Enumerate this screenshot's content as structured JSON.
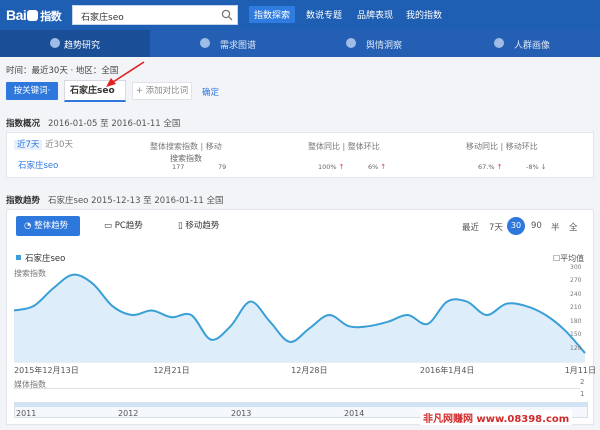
{
  "header": {
    "logo_text": "Bai",
    "logo_sub": "指数",
    "search_value": "石家庄seo",
    "nav": [
      "指数探索",
      "数说专题",
      "品牌表现",
      "我的指数"
    ]
  },
  "subnav": {
    "items": [
      "趋势研究",
      "需求图谱",
      "舆情洞察",
      "人群画像"
    ]
  },
  "filters": {
    "meta": "时间：最近30天 · 地区：全国",
    "by_keyword": "按关键词·",
    "keyword": "石家庄seo",
    "add_compare": "+ 添加对比词",
    "confirm": "确定"
  },
  "overview": {
    "title": "指数概况",
    "range": "2016-01-05 至 2016-01-11  全国",
    "tab_7": "近7天",
    "tab_30": "近30天",
    "head_search": "整体搜索指数 | 移动",
    "head_yoy": "整体同比 | 整体环比",
    "head_mobile": "移动同比 | 移动环比",
    "keyword": "石家庄seo",
    "sub_label": "搜索指数",
    "v_total": "177",
    "v_mobile": "79",
    "v_yoy": "100%",
    "v_mom": "6%",
    "v_myoy": "67.%",
    "v_mmom": "-8%"
  },
  "trend": {
    "title": "指数趋势",
    "range": "石家庄seo  2015-12-13 至 2016-01-11  全国",
    "tab_all": "整体趋势",
    "tab_pc": "PC趋势",
    "tab_mobile": "移动趋势",
    "recent": "最近",
    "r7": "7天",
    "r30": "30",
    "r90": "90",
    "rhalf": "半",
    "rall": "全",
    "legend": "石家庄seo",
    "avg": "平均值",
    "ylabel": "搜索指数",
    "media_label": "媒体指数",
    "years": [
      "2011",
      "2012",
      "2013",
      "2014"
    ]
  },
  "watermark": "非凡网赚网 www.08398.com",
  "chart_data": {
    "type": "line",
    "title": "",
    "xlabel": "",
    "ylabel": "搜索指数",
    "ylim": [
      90,
      300
    ],
    "yticks": [
      300,
      270,
      240,
      210,
      180,
      150,
      120
    ],
    "xtick_labels": [
      "2015年12月13日",
      "12月21日",
      "12月28日",
      "2016年1月4日",
      "1月11日"
    ],
    "xtick_index": [
      0,
      8,
      15,
      22,
      29
    ],
    "series": [
      {
        "name": "石家庄seo",
        "color": "#3a9fd6",
        "values": [
          205,
          215,
          255,
          285,
          265,
          215,
          195,
          205,
          190,
          195,
          140,
          170,
          225,
          180,
          135,
          165,
          195,
          170,
          170,
          180,
          195,
          175,
          225,
          225,
          195,
          220,
          215,
          195,
          160,
          110
        ]
      }
    ],
    "media_index": {
      "label": "媒体指数",
      "ylim": [
        0,
        2
      ],
      "yticks": [
        2,
        1
      ]
    }
  }
}
